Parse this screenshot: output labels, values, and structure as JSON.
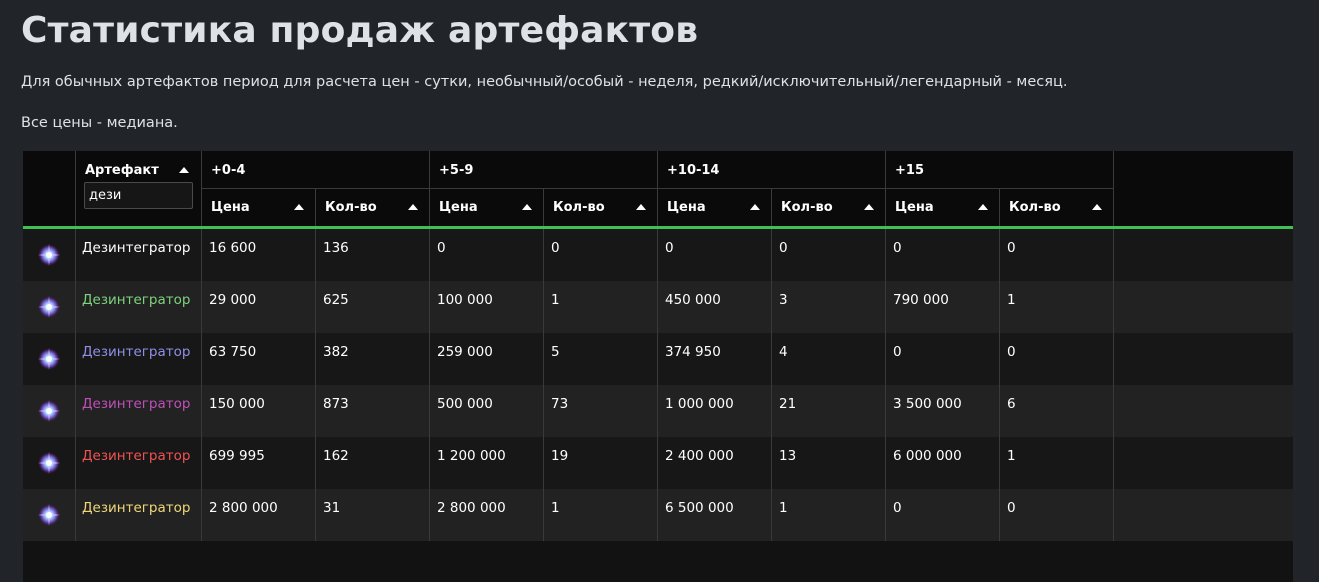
{
  "page": {
    "title": "Статистика продаж артефактов",
    "note_period": "Для обычных артефактов период для расчета цен - сутки, необычный/особый - неделя, редкий/исключительный/легендарный - месяц.",
    "note_median": "Все цены - медиана."
  },
  "table": {
    "artifact_header": "Артефакт",
    "filter_value": "дези",
    "groups": [
      "+0-4",
      "+5-9",
      "+10-14",
      "+15"
    ],
    "price_label": "Цена",
    "count_label": "Кол-во",
    "rows": [
      {
        "name": "Дезинтегратор",
        "color": "#ffffff",
        "cells": [
          "16 600",
          "136",
          "0",
          "0",
          "0",
          "0",
          "0",
          "0"
        ]
      },
      {
        "name": "Дезинтегратор",
        "color": "#7ed37e",
        "cells": [
          "29 000",
          "625",
          "100 000",
          "1",
          "450 000",
          "3",
          "790 000",
          "1"
        ]
      },
      {
        "name": "Дезинтегратор",
        "color": "#8f8fe8",
        "cells": [
          "63 750",
          "382",
          "259 000",
          "5",
          "374 950",
          "4",
          "0",
          "0"
        ]
      },
      {
        "name": "Дезинтегратор",
        "color": "#c04fb8",
        "cells": [
          "150 000",
          "873",
          "500 000",
          "73",
          "1 000 000",
          "21",
          "3 500 000",
          "6"
        ]
      },
      {
        "name": "Дезинтегратор",
        "color": "#f05353",
        "cells": [
          "699 995",
          "162",
          "1 200 000",
          "19",
          "2 400 000",
          "13",
          "6 000 000",
          "1"
        ]
      },
      {
        "name": "Дезинтегратор",
        "color": "#f0d878",
        "cells": [
          "2 800 000",
          "31",
          "2 800 000",
          "1",
          "6 500 000",
          "1",
          "0",
          "0"
        ]
      }
    ]
  },
  "colors": {
    "background": "#212529",
    "grid": "#121212",
    "accent": "#3fbf55"
  },
  "icons": {
    "artifact": "disintegrator-artifact-icon",
    "sort": "sort-ascending-icon"
  }
}
